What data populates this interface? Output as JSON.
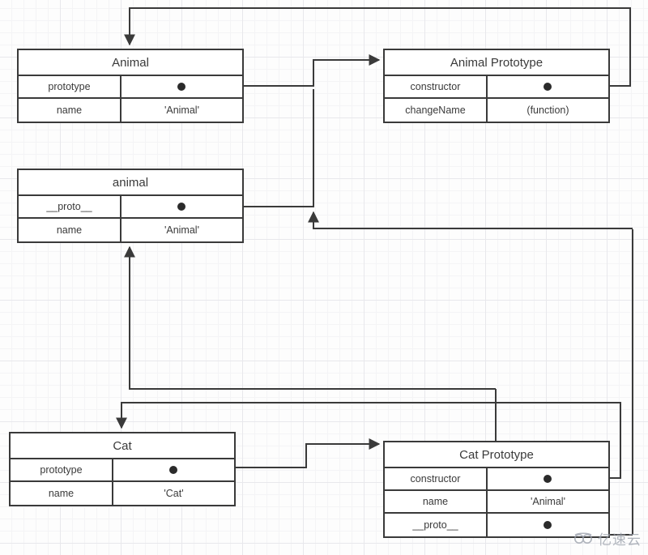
{
  "diagram": {
    "title": "JavaScript prototype chain diagram",
    "line_color": "#3a3a3a",
    "dot_color": "#2b2b2b",
    "background": "#fdfdfd",
    "grid_color": "#e8e8ec"
  },
  "nodes": [
    {
      "id": "animal-constructor",
      "title": "Animal",
      "rows": [
        {
          "key": "prototype",
          "value": "",
          "value_kind": "pointer-dot"
        },
        {
          "key": "name",
          "value": "'Animal'",
          "value_kind": "text"
        }
      ]
    },
    {
      "id": "animal-prototype",
      "title": "Animal Prototype",
      "rows": [
        {
          "key": "constructor",
          "value": "",
          "value_kind": "pointer-dot"
        },
        {
          "key": "changeName",
          "value": "(function)",
          "value_kind": "text"
        }
      ]
    },
    {
      "id": "animal-instance",
      "title": "animal",
      "rows": [
        {
          "key": "__proto__",
          "value": "",
          "value_kind": "pointer-dot"
        },
        {
          "key": "name",
          "value": "'Animal'",
          "value_kind": "text"
        }
      ]
    },
    {
      "id": "cat-constructor",
      "title": "Cat",
      "rows": [
        {
          "key": "prototype",
          "value": "",
          "value_kind": "pointer-dot"
        },
        {
          "key": "name",
          "value": "'Cat'",
          "value_kind": "text"
        }
      ]
    },
    {
      "id": "cat-prototype",
      "title": "Cat Prototype",
      "rows": [
        {
          "key": "constructor",
          "value": "",
          "value_kind": "pointer-dot"
        },
        {
          "key": "name",
          "value": "'Animal'",
          "value_kind": "text"
        },
        {
          "key": "__proto__",
          "value": "",
          "value_kind": "pointer-dot"
        }
      ]
    }
  ],
  "watermark": {
    "text": "亿速云",
    "icon": "cloud-logo-icon"
  }
}
